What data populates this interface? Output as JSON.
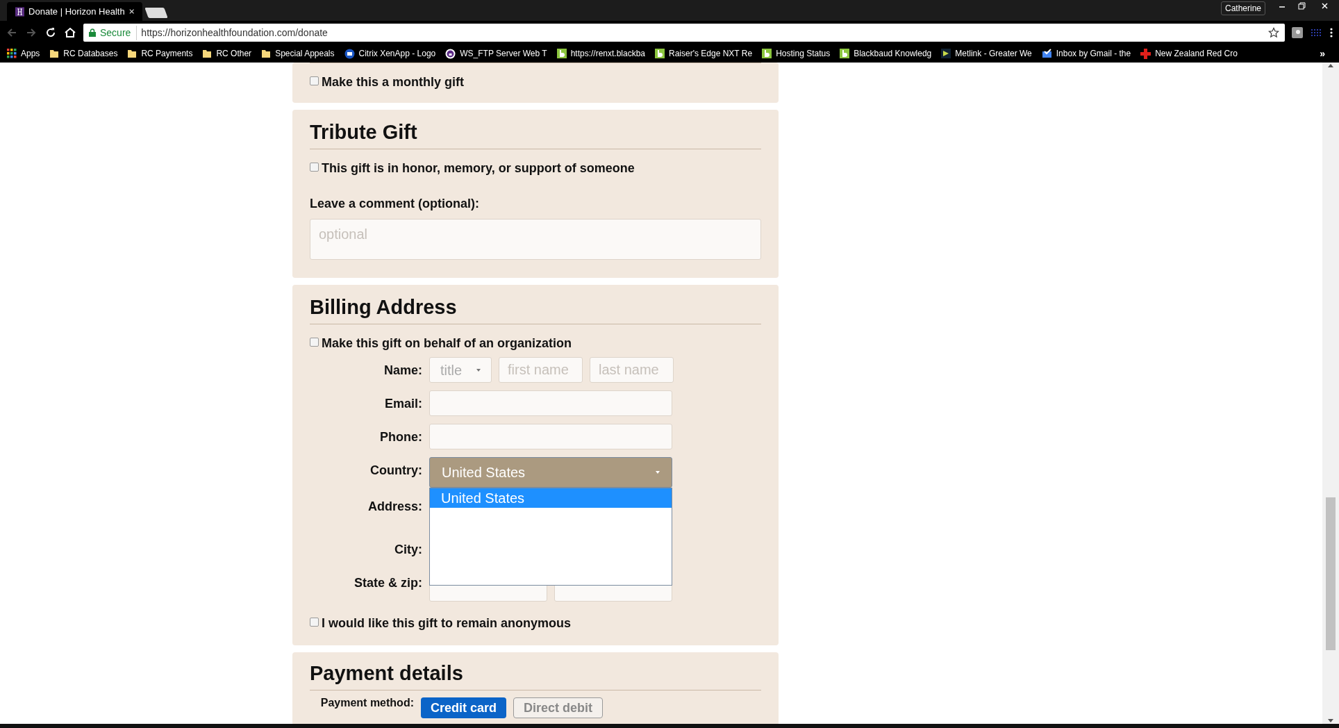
{
  "browser": {
    "tab_title": "Donate | Horizon Health",
    "user": "Catherine",
    "secure_label": "Secure",
    "url": "https://horizonhealthfoundation.com/donate",
    "bookmarks": [
      {
        "kind": "apps",
        "label": "Apps"
      },
      {
        "kind": "folder",
        "label": "RC Databases"
      },
      {
        "kind": "folder",
        "label": "RC Payments"
      },
      {
        "kind": "folder",
        "label": "RC Other"
      },
      {
        "kind": "folder",
        "label": "Special Appeals"
      },
      {
        "kind": "citrix",
        "label": "Citrix XenApp - Logo"
      },
      {
        "kind": "ftp",
        "label": "WS_FTP Server Web T"
      },
      {
        "kind": "b",
        "label": "https://renxt.blackba"
      },
      {
        "kind": "b",
        "label": "Raiser's Edge NXT Re"
      },
      {
        "kind": "b",
        "label": "Hosting Status"
      },
      {
        "kind": "b",
        "label": "Blackbaud Knowledg"
      },
      {
        "kind": "metlink",
        "label": "Metlink - Greater We"
      },
      {
        "kind": "inbox",
        "label": "Inbox by Gmail - the"
      },
      {
        "kind": "cross",
        "label": "New Zealand Red Cro"
      }
    ],
    "overflow": "»"
  },
  "monthly": {
    "label": "Make this a monthly gift",
    "checked": false
  },
  "tribute": {
    "title": "Tribute Gift",
    "honor": {
      "label": "This gift is in honor, memory, or support of someone",
      "checked": false
    },
    "comment_label": "Leave a comment (optional):",
    "comment_placeholder": "optional"
  },
  "billing": {
    "title": "Billing Address",
    "organization": {
      "label": "Make this gift on behalf of an organization",
      "checked": false
    },
    "fields": [
      {
        "kind": "name",
        "label": "Name:",
        "title_placeholder": "title",
        "first_placeholder": "first name",
        "last_placeholder": "last name"
      },
      {
        "kind": "text",
        "label": "Email:"
      },
      {
        "kind": "text",
        "label": "Phone:"
      },
      {
        "kind": "select",
        "label": "Country:",
        "value": "United States",
        "expanded": true,
        "options": [
          {
            "label": "United States",
            "selected": true
          }
        ]
      },
      {
        "kind": "covered",
        "label": "Address:"
      },
      {
        "kind": "covered",
        "label": "City:"
      },
      {
        "kind": "state_zip",
        "label": "State & zip:"
      }
    ],
    "anonymous": {
      "label": "I would like this gift to remain anonymous",
      "checked": false
    }
  },
  "payment": {
    "title": "Payment details",
    "method_label": "Payment method:",
    "methods": [
      {
        "label": "Credit card",
        "selected": true
      },
      {
        "label": "Direct debit",
        "selected": false
      }
    ]
  }
}
